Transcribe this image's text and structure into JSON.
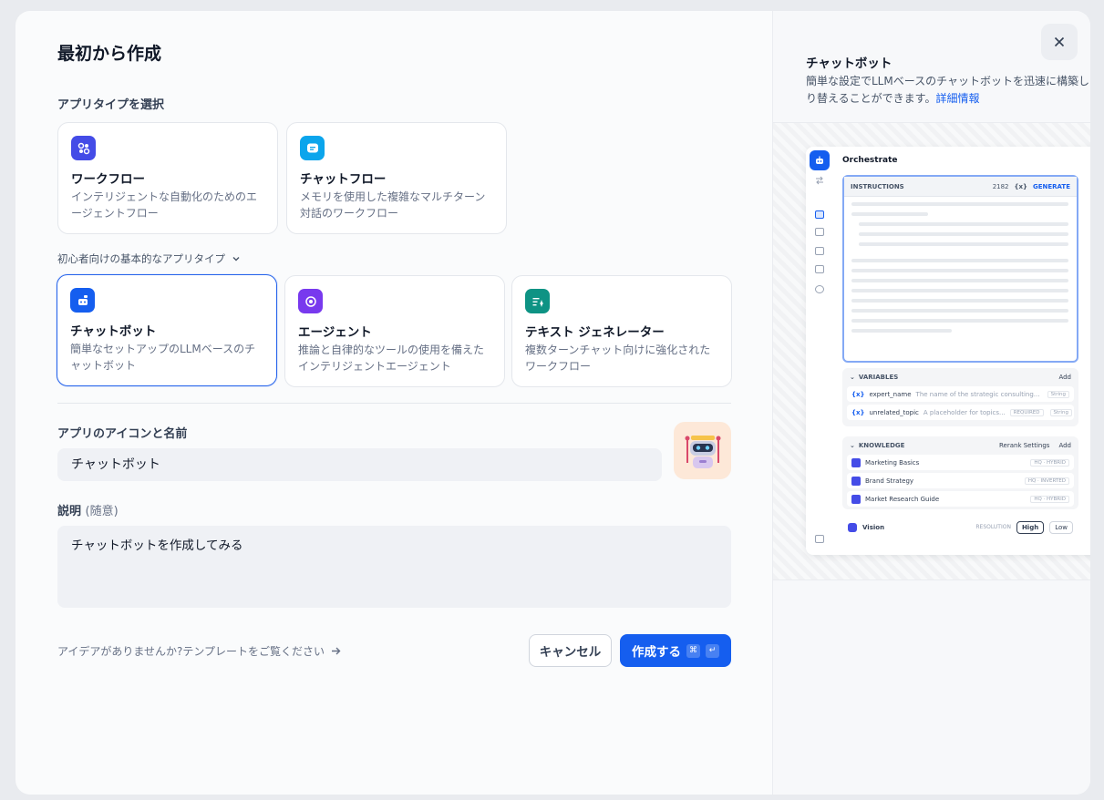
{
  "dialog": {
    "title": "最初から作成",
    "app_type_label": "アプリタイプを選択",
    "primary_types": [
      {
        "title": "ワークフロー",
        "desc": "インテリジェントな自動化のためのエージェントフロー",
        "color": "#444ce7",
        "icon": "workflow-icon"
      },
      {
        "title": "チャットフロー",
        "desc": "メモリを使用した複雑なマルチターン対話のワークフロー",
        "color": "#0ba5ec",
        "icon": "chatflow-icon"
      }
    ],
    "beginner_toggle": "初心者向けの基本的なアプリタイプ",
    "beginner_types": [
      {
        "title": "チャットボット",
        "desc": "簡単なセットアップのLLMベースのチャットボット",
        "color": "#155eef",
        "icon": "chatbot-icon",
        "selected": true
      },
      {
        "title": "エージェント",
        "desc": "推論と自律的なツールの使用を備えたインテリジェントエージェント",
        "color": "#7839ee",
        "icon": "agent-icon",
        "selected": false
      },
      {
        "title": "テキスト ジェネレーター",
        "desc": "複数ターンチャット向けに強化されたワークフロー",
        "color": "#0e9384",
        "icon": "text-generator-icon",
        "selected": false
      }
    ],
    "icon_name_label": "アプリのアイコンと名前",
    "app_name_value": "チャットボット",
    "desc_label": "説明",
    "desc_optional": "(随意)",
    "desc_value": "チャットボットを作成してみる",
    "template_link": "アイデアがありませんか?テンプレートをご覧ください",
    "cancel_label": "キャンセル",
    "create_label": "作成する",
    "create_kbd": [
      "⌘",
      "↵"
    ]
  },
  "preview": {
    "title": "チャットボット",
    "desc_line1": "簡単な設定でLLMベースのチャットボットを迅速に構築します",
    "desc_line2": "り替えることができます。",
    "more_link": "詳細情報",
    "mock": {
      "heading": "Orchestrate",
      "instructions_label": "INSTRUCTIONS",
      "instructions_count": "2182",
      "var_btn": "{x}",
      "generate_label": "GENERATE",
      "variables_label": "VARIABLES",
      "add_label": "Add",
      "variables": [
        {
          "name": "expert_name",
          "desc": "The name of the strategic consulting...",
          "required": "",
          "type": "String"
        },
        {
          "name": "unrelated_topic",
          "desc": "A placeholder for topics...",
          "required": "REQUIRED",
          "type": "String"
        }
      ],
      "knowledge_label": "KNOWLEDGE",
      "rerank_label": "Rerank Settings",
      "knowledge": [
        {
          "name": "Marketing Basics",
          "tag": "HQ · HYBRID"
        },
        {
          "name": "Brand Strategy",
          "tag": "HQ · INVERTED"
        },
        {
          "name": "Market Research Guide",
          "tag": "HQ · HYBRID"
        }
      ],
      "vision_label": "Vision",
      "resolution_label": "RESOLUTION",
      "high_label": "High",
      "low_label": "Low"
    }
  }
}
